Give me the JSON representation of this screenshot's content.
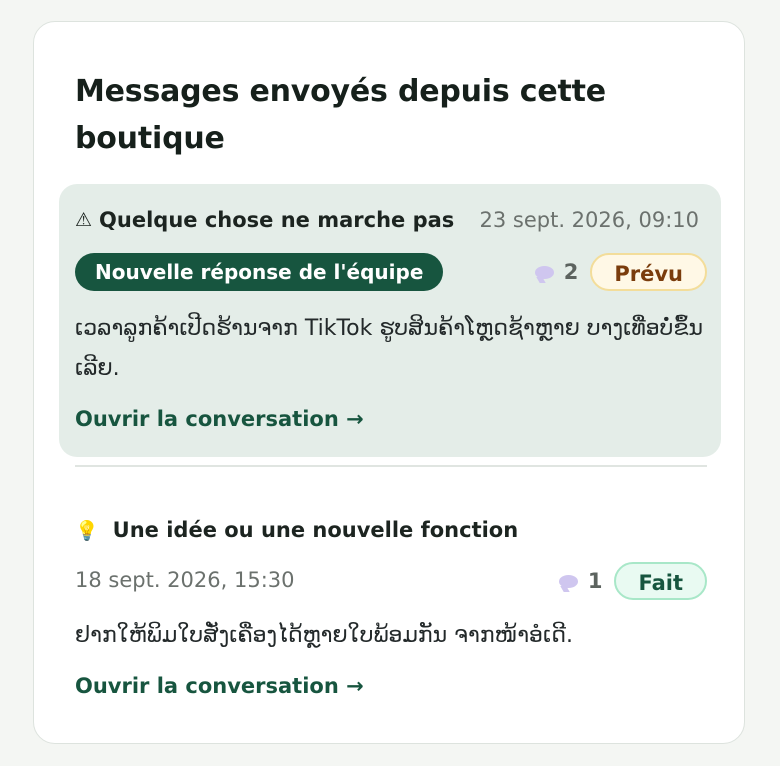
{
  "panel": {
    "title": "Messages envoyés depuis cette boutique"
  },
  "messages": [
    {
      "category": "Quelque chose ne marche pas",
      "category_icon": "⚠",
      "category_icon_name": "warning-icon",
      "date": "23 sept. 2026, 09:10",
      "new_reply_badge": "Nouvelle réponse de l'équipe",
      "comment_count": "2",
      "status": "Prévu",
      "status_color": "#7a3c0c",
      "body": "ເວລາລູກຄ້າເປີດຮ້ານຈາກ TikTok ຮູບສິນຄ້າໂຫຼດຊ້າຫຼາຍ ບາງເທື່ອບໍ່ຂຶ້ນເລີຍ.",
      "link": "Ouvrir la conversation →"
    },
    {
      "category": "Une idée ou une nouvelle fonction",
      "category_icon": "💡",
      "category_icon_name": "lightbulb-icon",
      "date": "18 sept. 2026, 15:30",
      "comment_count": "1",
      "status": "Fait",
      "status_color": "#17553f",
      "body": "ຢາກໃຫ້ພິມໃບສັ່ງເຄື່ອງໄດ້ຫຼາຍໃບພ້ອມກັນ ຈາກໜ້າອໍເດີ.",
      "link": "Ouvrir la conversation →"
    }
  ],
  "colors": {
    "accent": "#17553f",
    "highlight_bg": "#e4ede8",
    "page_bg": "#f4f6f3"
  }
}
